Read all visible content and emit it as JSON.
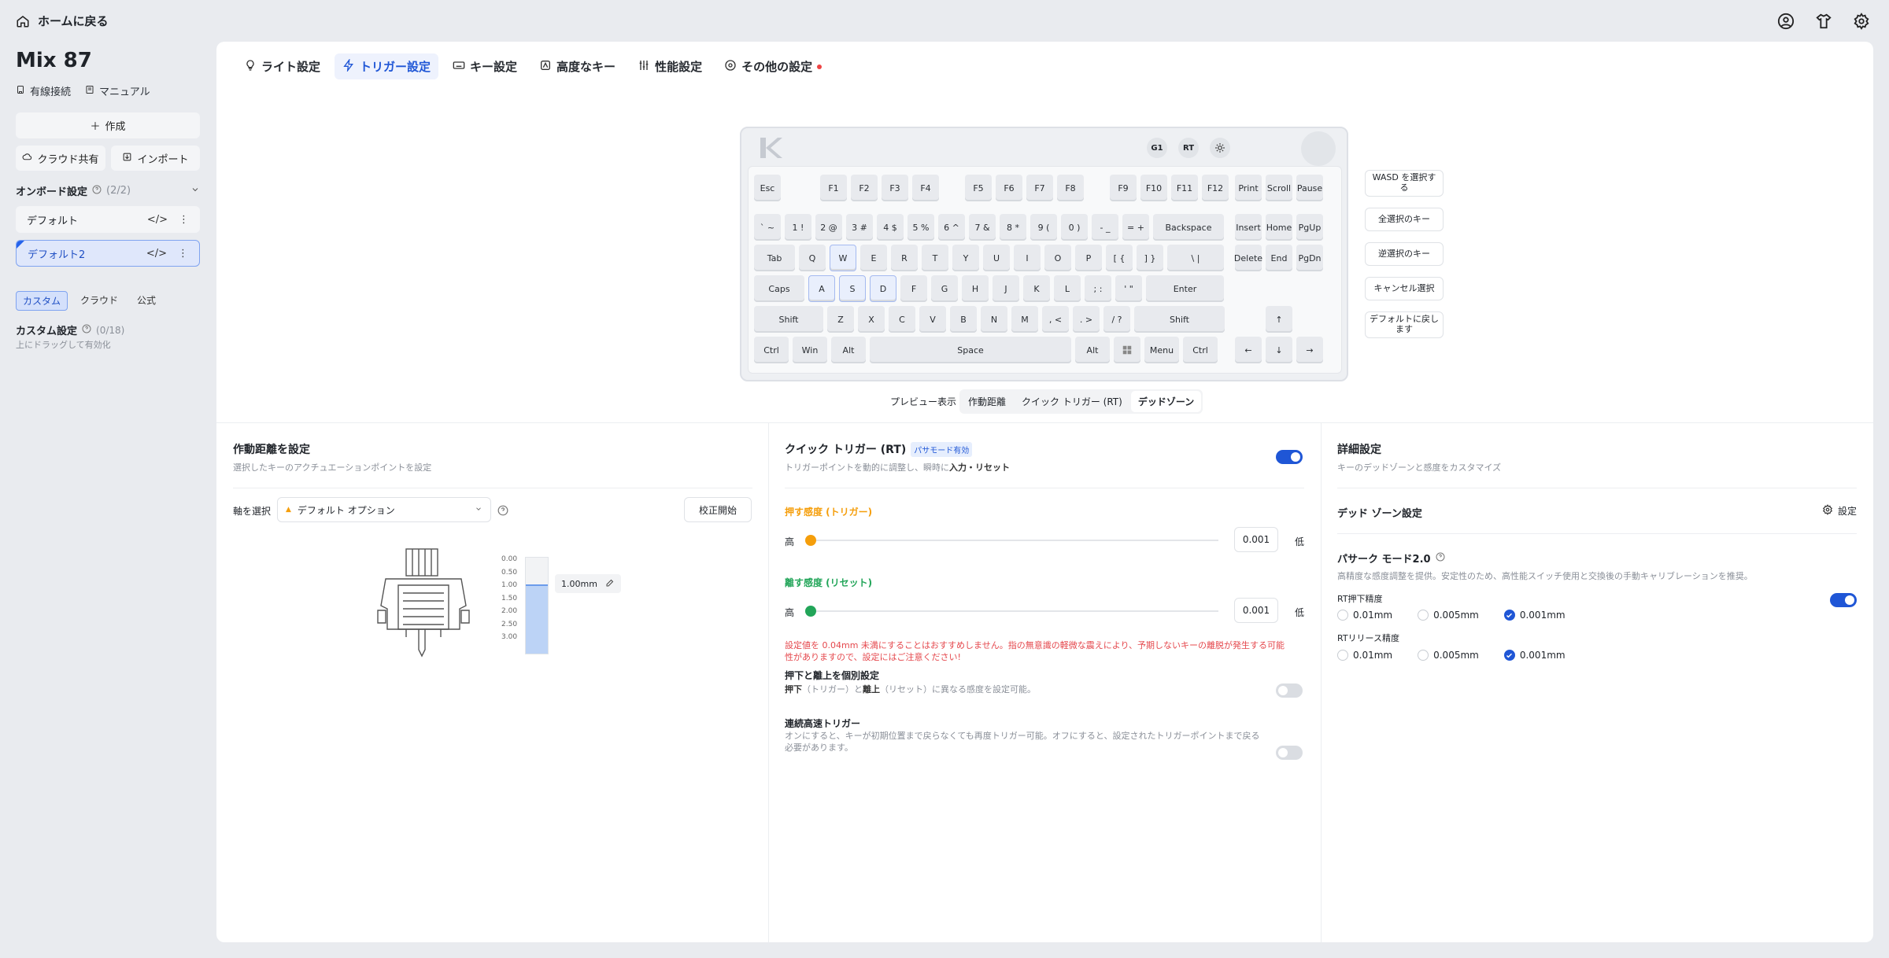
{
  "header": {
    "home_label": "ホームに戻る"
  },
  "sidebar": {
    "device_name": "Mix 87",
    "connection": "有線接続",
    "manual": "マニュアル",
    "create": "作成",
    "cloud_share": "クラウド共有",
    "import": "インポート",
    "onboard_title": "オンボード設定",
    "onboard_count": "(2/2)",
    "profiles": [
      {
        "label": "デフォルト",
        "selected": false
      },
      {
        "label": "デフォルト2",
        "selected": true
      }
    ],
    "filter_tabs": [
      "カスタム",
      "クラウド",
      "公式"
    ],
    "active_filter": "カスタム",
    "custom_title": "カスタム設定",
    "custom_count": "(0/18)",
    "custom_hint": "上にドラッグして有効化"
  },
  "tabs": [
    {
      "label": "ライト設定",
      "icon": "bulb-icon"
    },
    {
      "label": "トリガー設定",
      "icon": "lightning-icon",
      "active": true
    },
    {
      "label": "キー設定",
      "icon": "keyboard-icon"
    },
    {
      "label": "高度なキー",
      "icon": "advanced-key-icon"
    },
    {
      "label": "性能設定",
      "icon": "sliders-icon"
    },
    {
      "label": "その他の設定",
      "icon": "gear-icon",
      "badge": true
    }
  ],
  "keyboard": {
    "top_buttons": [
      "G1",
      "RT"
    ],
    "rows": [
      [
        "Esc",
        "F1",
        "F2",
        "F3",
        "F4",
        "F5",
        "F6",
        "F7",
        "F8",
        "F9",
        "F10",
        "F11",
        "F12",
        "Print",
        "Scroll",
        "Pause"
      ],
      [
        "` ~",
        "1 !",
        "2 @",
        "3 #",
        "4 $",
        "5 %",
        "6 ^",
        "7 &",
        "8 *",
        "9 (",
        "0 )",
        "- _",
        "= +",
        "Backspace",
        "Insert",
        "Home",
        "PgUp"
      ],
      [
        "Tab",
        "Q",
        "W",
        "E",
        "R",
        "T",
        "Y",
        "U",
        "I",
        "O",
        "P",
        "[ {",
        "] }",
        "\\ |",
        "Delete",
        "End",
        "PgDn"
      ],
      [
        "Caps",
        "A",
        "S",
        "D",
        "F",
        "G",
        "H",
        "J",
        "K",
        "L",
        "; :",
        "' \"",
        "Enter"
      ],
      [
        "Shift",
        "Z",
        "X",
        "C",
        "V",
        "B",
        "N",
        "M",
        ", <",
        ". >",
        "/ ?",
        "Shift",
        "↑"
      ],
      [
        "Ctrl",
        "Win",
        "Alt",
        "Space",
        "Alt",
        "",
        "Menu",
        "Ctrl",
        "←",
        "↓",
        "→"
      ]
    ],
    "selected_keys": [
      "W",
      "A",
      "S",
      "D"
    ]
  },
  "side_buttons": [
    "WASD を選択する",
    "全選択のキー",
    "逆選択のキー",
    "キャンセル選択",
    "デフォルトに戻します"
  ],
  "preview": {
    "label": "プレビュー表示",
    "options": [
      "作動距離",
      "クイック トリガー (RT)",
      "デッドゾーン"
    ],
    "active": "デッドゾーン"
  },
  "actuation": {
    "title": "作動距離を設定",
    "subtitle": "選択したキーのアクチュエーションポイントを設定",
    "axis_label": "軸を選択",
    "axis_value": "デフォルト オプション",
    "calibrate": "校正開始",
    "scale": [
      "0.00",
      "0.50",
      "1.00",
      "1.50",
      "2.00",
      "2.50",
      "3.00"
    ],
    "value_label": "1.00mm",
    "fill_fraction": 0.72
  },
  "quick_trigger": {
    "title": "クイック トリガー (RT)",
    "badge": "パサモード有効",
    "subtitle_pre": "トリガーポイントを動的に調整し、瞬時に",
    "subtitle_bold": "入力・リセット",
    "enabled": true,
    "press_title": "押す感度 (トリガー)",
    "release_title": "離す感度 (リセット)",
    "high": "高",
    "low": "低",
    "press_value": "0.001",
    "release_value": "0.001",
    "press_color": "#f59e0b",
    "release_color": "#22a559",
    "warning": "設定値を 0.04mm 未満にすることはおすすめしません。指の無意識の軽微な震えにより、予期しないキーの離脱が発生する可能性がありますので、設定にはご注意ください!",
    "separate_title": "押下と離上を個別設定",
    "separate_desc_1": "押下",
    "separate_desc_2": "（トリガー）と",
    "separate_desc_3": "離上",
    "separate_desc_4": "（リセット）に異なる感度を設定可能。",
    "separate_enabled": false,
    "continuous_title": "連続高速トリガー",
    "continuous_desc": "オンにすると、キーが初期位置まで戻らなくても再度トリガー可能。オフにすると、設定されたトリガーポイントまで戻る必要があります。",
    "continuous_enabled": false
  },
  "advanced": {
    "title": "詳細設定",
    "subtitle": "キーのデッドゾーンと感度をカスタマイズ",
    "deadzone_title": "デッド ゾーン設定",
    "deadzone_action": "設定",
    "pasak_title": "パサーク モード2.0",
    "pasak_desc": "高精度な感度調整を提供。安定性のため、高性能スイッチ使用と交換後の手動キャリブレーションを推奨。",
    "pasak_enabled": true,
    "press_precision_title": "RT押下精度",
    "release_precision_title": "RTリリース精度",
    "options": [
      "0.01mm",
      "0.005mm",
      "0.001mm"
    ],
    "press_selected": "0.001mm",
    "release_selected": "0.001mm"
  },
  "colors": {
    "accent": "#1f56d6",
    "warning": "#e5484d"
  }
}
